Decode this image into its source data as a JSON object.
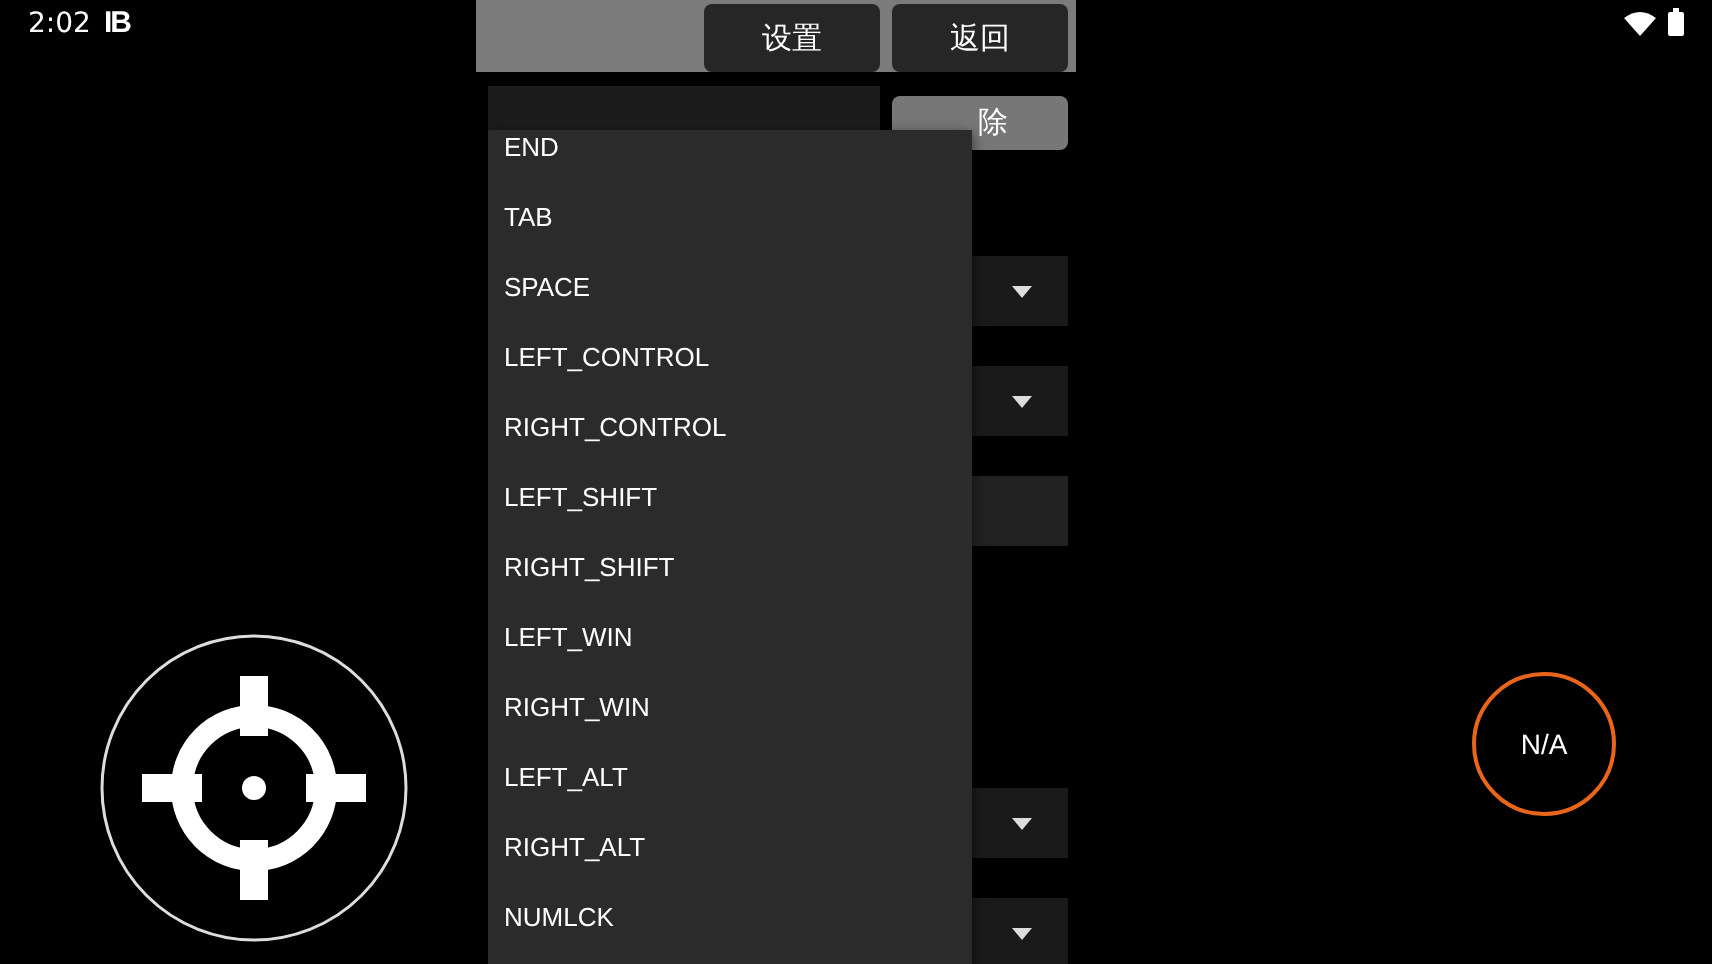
{
  "status_bar": {
    "time": "2:02",
    "notification": "IB"
  },
  "toolbar": {
    "buttons": [
      {
        "label": "设置"
      },
      {
        "label": "返回"
      }
    ]
  },
  "editor": {
    "delete_button": "除",
    "rows": [
      {
        "kind": "select"
      },
      {
        "kind": "select"
      },
      {
        "kind": "field"
      },
      {
        "kind": "blank"
      },
      {
        "kind": "select"
      },
      {
        "kind": "select"
      }
    ]
  },
  "key_menu": {
    "items": [
      "END",
      "TAB",
      "SPACE",
      "LEFT_CONTROL",
      "RIGHT_CONTROL",
      "LEFT_SHIFT",
      "RIGHT_SHIFT",
      "LEFT_WIN",
      "RIGHT_WIN",
      "LEFT_ALT",
      "RIGHT_ALT",
      "NUMLCK"
    ]
  },
  "action_button": {
    "label": "N/A"
  }
}
